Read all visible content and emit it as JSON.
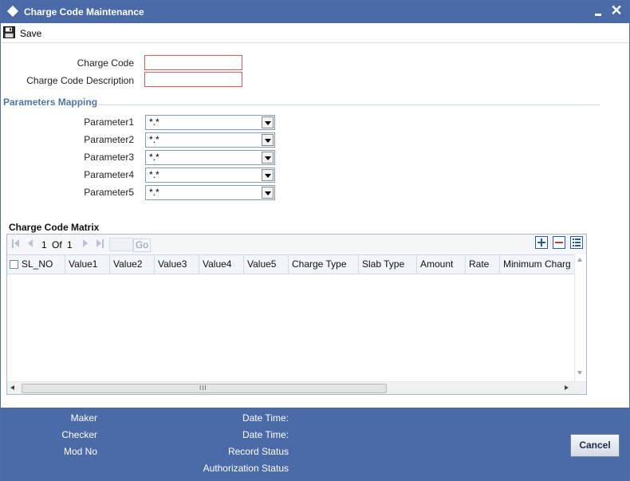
{
  "window": {
    "title": "Charge Code Maintenance",
    "minimize_glyph": "_",
    "close_glyph": "✕"
  },
  "toolbar": {
    "save_label": "Save",
    "save_icon": "floppy-disk-icon"
  },
  "form": {
    "charge_code_label": "Charge Code",
    "charge_code_value": "",
    "charge_code_desc_label": "Charge Code Description",
    "charge_code_desc_value": ""
  },
  "parameters": {
    "section_title": "Parameters Mapping",
    "items": [
      {
        "label": "Parameter1",
        "value": "*.*"
      },
      {
        "label": "Parameter2",
        "value": "*.*"
      },
      {
        "label": "Parameter3",
        "value": "*.*"
      },
      {
        "label": "Parameter4",
        "value": "*.*"
      },
      {
        "label": "Parameter5",
        "value": "*.*"
      }
    ]
  },
  "matrix": {
    "title": "Charge Code Matrix",
    "pager": {
      "current": "1",
      "of_label": "Of",
      "total": "1",
      "go_label": "Go"
    },
    "columns": [
      "SL_NO",
      "Value1",
      "Value2",
      "Value3",
      "Value4",
      "Value5",
      "Charge Type",
      "Slab Type",
      "Amount",
      "Rate",
      "Minimum Charg"
    ],
    "rows": [],
    "scroll_grip": "III"
  },
  "footer": {
    "maker_label": "Maker",
    "checker_label": "Checker",
    "mod_no_label": "Mod No",
    "date_time_label_1": "Date Time:",
    "date_time_label_2": "Date Time:",
    "record_status_label": "Record Status",
    "authorization_status_label": "Authorization Status",
    "cancel_label": "Cancel"
  },
  "colors": {
    "title_bar": "#4a6aa8",
    "section_title": "#4f74a8",
    "required_border": "#e45656"
  }
}
